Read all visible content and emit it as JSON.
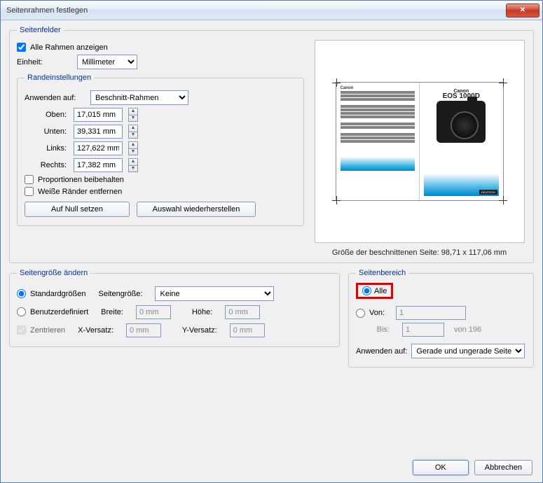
{
  "window": {
    "title": "Seitenrahmen festlegen"
  },
  "seitenfelder": {
    "legend": "Seitenfelder",
    "show_all_frames_label": "Alle Rahmen anzeigen",
    "show_all_frames_checked": true,
    "unit_label": "Einheit:",
    "unit_value": "Millimeter"
  },
  "margins": {
    "legend": "Randeinstellungen",
    "apply_to_label": "Anwenden auf:",
    "apply_to_value": "Beschnitt-Rahmen",
    "top_label": "Oben:",
    "top_value": "17,015 mm",
    "bottom_label": "Unten:",
    "bottom_value": "39,331 mm",
    "left_label": "Links:",
    "left_value": "127,622 mm",
    "right_label": "Rechts:",
    "right_value": "17,382 mm",
    "keep_proportions_label": "Proportionen beibehalten",
    "remove_white_label": "Weiße Ränder entfernen",
    "reset_label": "Auf Null setzen",
    "restore_label": "Auswahl wiederherstellen"
  },
  "preview": {
    "logo_text": "Canon",
    "model_text": "EOS 1000D",
    "badge_text": "DEUTSCH",
    "size_caption": "Größe der beschnittenen Seite: 98,71 x 117,06 mm"
  },
  "resize": {
    "legend": "Seitengröße ändern",
    "standard_label": "Standardgrößen",
    "custom_label": "Benutzerdefiniert",
    "pagesize_label": "Seitengröße:",
    "pagesize_value": "Keine",
    "width_label": "Breite:",
    "width_value": "0 mm",
    "height_label": "Höhe:",
    "height_value": "0 mm",
    "center_label": "Zentrieren",
    "xoffset_label": "X-Versatz:",
    "xoffset_value": "0 mm",
    "yoffset_label": "Y-Versatz:",
    "yoffset_value": "0 mm"
  },
  "range": {
    "legend": "Seitenbereich",
    "all_label": "Alle",
    "from_label": "Von:",
    "from_value": "1",
    "to_label": "Bis:",
    "to_value": "1",
    "of_label": "von 196",
    "apply_to_label": "Anwenden auf:",
    "apply_to_value": "Gerade und ungerade Seiten"
  },
  "footer": {
    "ok": "OK",
    "cancel": "Abbrechen"
  }
}
